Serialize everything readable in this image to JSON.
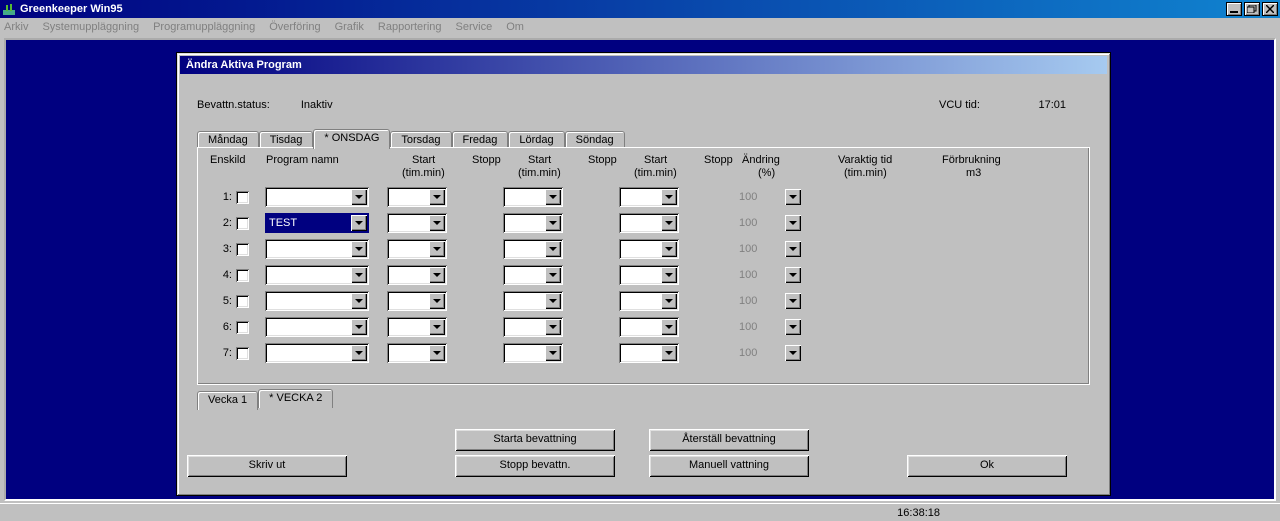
{
  "app": {
    "title": "Greenkeeper Win95"
  },
  "menu": [
    "Arkiv",
    "Systemuppläggning",
    "Programuppläggning",
    "Överföring",
    "Grafik",
    "Rapportering",
    "Service",
    "Om"
  ],
  "statusbar": {
    "time": "16:38:18"
  },
  "dialog": {
    "title": "Ändra Aktiva Program",
    "bevattn_label": "Bevattn.status:",
    "bevattn_value": "Inaktiv",
    "vcu_label": "VCU tid:",
    "vcu_time": "17:01",
    "day_tabs": [
      "Måndag",
      "Tisdag",
      "* ONSDAG",
      "Torsdag",
      "Fredag",
      "Lördag",
      "Söndag"
    ],
    "active_day_tab": 2,
    "headers": {
      "enskild": "Enskild",
      "program": "Program namn",
      "start": "Start",
      "start_sub": "(tim.min)",
      "stopp": "Stopp",
      "andring": "Ändring",
      "andring_sub": "(%)",
      "varaktig": "Varaktig tid",
      "varaktig_sub": "(tim.min)",
      "forbruk": "Förbrukning",
      "forbruk_sub": "m3"
    },
    "rows": [
      {
        "n": "1:",
        "prog": "",
        "sel": false,
        "andr": "100"
      },
      {
        "n": "2:",
        "prog": "TEST",
        "sel": true,
        "andr": "100"
      },
      {
        "n": "3:",
        "prog": "",
        "sel": false,
        "andr": "100"
      },
      {
        "n": "4:",
        "prog": "",
        "sel": false,
        "andr": "100"
      },
      {
        "n": "5:",
        "prog": "",
        "sel": false,
        "andr": "100"
      },
      {
        "n": "6:",
        "prog": "",
        "sel": false,
        "andr": "100"
      },
      {
        "n": "7:",
        "prog": "",
        "sel": false,
        "andr": "100"
      }
    ],
    "week_tabs": [
      "Vecka 1",
      "* VECKA 2"
    ],
    "active_week_tab": 1,
    "buttons": {
      "skriv_ut": "Skriv ut",
      "starta": "Starta bevattning",
      "stopp": "Stopp bevattn.",
      "aterstall": "Återställ bevattning",
      "manuell": "Manuell vattning",
      "ok": "Ok"
    }
  }
}
